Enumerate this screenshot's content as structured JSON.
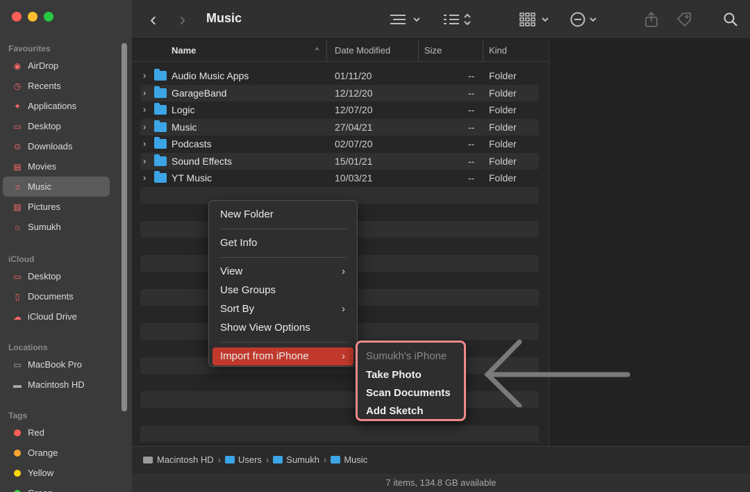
{
  "toolbar": {
    "title": "Music",
    "back_glyph": "‹",
    "forward_glyph": "›"
  },
  "sidebar": {
    "sections": [
      {
        "header": "Favourites",
        "items": [
          {
            "label": "AirDrop",
            "icon": "airdrop-icon",
            "glyph": "◉"
          },
          {
            "label": "Recents",
            "icon": "clock-icon",
            "glyph": "◷"
          },
          {
            "label": "Applications",
            "icon": "applications-icon",
            "glyph": "✦"
          },
          {
            "label": "Desktop",
            "icon": "desktop-icon",
            "glyph": "▭"
          },
          {
            "label": "Downloads",
            "icon": "downloads-icon",
            "glyph": "⊙"
          },
          {
            "label": "Movies",
            "icon": "movies-icon",
            "glyph": "▤"
          },
          {
            "label": "Music",
            "icon": "music-icon",
            "glyph": "♫",
            "active": true
          },
          {
            "label": "Pictures",
            "icon": "pictures-icon",
            "glyph": "▨"
          },
          {
            "label": "Sumukh",
            "icon": "home-icon",
            "glyph": "⌂"
          }
        ]
      },
      {
        "header": "iCloud",
        "items": [
          {
            "label": "Desktop",
            "icon": "desktop-icon",
            "glyph": "▭"
          },
          {
            "label": "Documents",
            "icon": "documents-icon",
            "glyph": "▯"
          },
          {
            "label": "iCloud Drive",
            "icon": "cloud-icon",
            "glyph": "☁"
          }
        ]
      },
      {
        "header": "Locations",
        "items": [
          {
            "label": "MacBook Pro",
            "icon": "laptop-icon",
            "glyph": "▭"
          },
          {
            "label": "Macintosh HD",
            "icon": "disk-icon",
            "glyph": "▬"
          }
        ]
      },
      {
        "header": "Tags",
        "items": [
          {
            "label": "Red",
            "color": "#ff5f57"
          },
          {
            "label": "Orange",
            "color": "#ffa332"
          },
          {
            "label": "Yellow",
            "color": "#ffd60a"
          },
          {
            "label": "Green",
            "color": "#32d74b"
          }
        ]
      }
    ]
  },
  "columns": {
    "name": "Name",
    "date": "Date Modified",
    "size": "Size",
    "kind": "Kind"
  },
  "files": [
    {
      "name": "Audio Music Apps",
      "date": "01/11/20",
      "size": "--",
      "kind": "Folder"
    },
    {
      "name": "GarageBand",
      "date": "12/12/20",
      "size": "--",
      "kind": "Folder"
    },
    {
      "name": "Logic",
      "date": "12/07/20",
      "size": "--",
      "kind": "Folder"
    },
    {
      "name": "Music",
      "date": "27/04/21",
      "size": "--",
      "kind": "Folder"
    },
    {
      "name": "Podcasts",
      "date": "02/07/20",
      "size": "--",
      "kind": "Folder"
    },
    {
      "name": "Sound Effects",
      "date": "15/01/21",
      "size": "--",
      "kind": "Folder"
    },
    {
      "name": "YT Music",
      "date": "10/03/21",
      "size": "--",
      "kind": "Folder"
    }
  ],
  "context_menu": {
    "items": [
      {
        "label": "New Folder"
      },
      {
        "separator": true
      },
      {
        "label": "Get Info"
      },
      {
        "separator": true
      },
      {
        "label": "View",
        "submenu": true
      },
      {
        "label": "Use Groups"
      },
      {
        "label": "Sort By",
        "submenu": true
      },
      {
        "label": "Show View Options"
      },
      {
        "separator": true
      },
      {
        "label": "Import from iPhone",
        "submenu": true,
        "highlighted": true
      }
    ],
    "highlight_color": "#c0392b"
  },
  "submenu": {
    "device": "Sumukh's iPhone",
    "items": [
      "Take Photo",
      "Scan Documents",
      "Add Sketch"
    ],
    "border_color": "#f18a8a"
  },
  "pathbar": [
    "Macintosh HD",
    "Users",
    "Sumukh",
    "Music"
  ],
  "status": "7 items, 134.8 GB available"
}
